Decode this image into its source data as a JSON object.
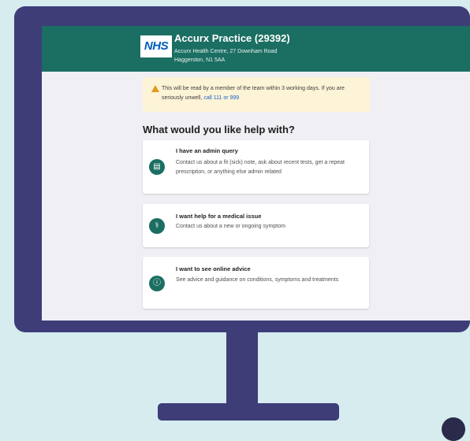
{
  "header": {
    "logo_text": "NHS",
    "practice_name": "Accurx Practice (29392)",
    "address_line1": "Accurx Health Centre, 27 Downham Road",
    "address_line2": "Haggerston, N1 5AA"
  },
  "notice": {
    "text": "This will be read by a member of the team within 3 working days. If you are seriously unwell,",
    "link_text": "call 111 or 999"
  },
  "question": "What would you like help with?",
  "options": [
    {
      "title": "I have an admin query",
      "description": "Contact us about a fit (sick) note, ask about recent tests, get a repeat prescription, or anything else admin related",
      "icon": "document-icon"
    },
    {
      "title": "I want help for a medical issue",
      "description": "Contact us about a new or ongoing symptom",
      "icon": "stethoscope-icon"
    },
    {
      "title": "I want to see online advice",
      "description": "See advice and guidance on conditions, symptoms and treatments",
      "icon": "info-icon"
    }
  ],
  "colors": {
    "header": "#1b6e62",
    "monitor": "#3e3d78",
    "background": "#d6ecef",
    "notice": "#fdf3d6",
    "link": "#1a63c9"
  }
}
